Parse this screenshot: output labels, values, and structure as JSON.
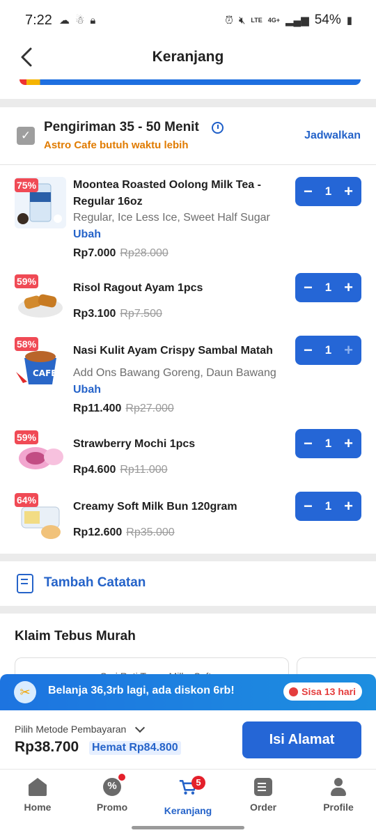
{
  "status_bar": {
    "time": "7:22",
    "battery": "54%",
    "network": "LTE",
    "net_gen": "4G+"
  },
  "header": {
    "title": "Keranjang"
  },
  "delivery": {
    "title": "Pengiriman 35 - 50 Menit",
    "subtitle": "Astro Cafe butuh waktu lebih",
    "schedule_label": "Jadwalkan"
  },
  "items": [
    {
      "discount": "75%",
      "name": "Moontea Roasted Oolong Milk Tea - Regular 16oz",
      "variant": "Regular, Ice Less Ice, Sweet Half Sugar",
      "edit_label": "Ubah",
      "price": "Rp7.000",
      "old_price": "Rp28.000",
      "qty": "1"
    },
    {
      "discount": "59%",
      "name": "Risol Ragout Ayam 1pcs",
      "price": "Rp3.100",
      "old_price": "Rp7.500",
      "qty": "1"
    },
    {
      "discount": "58%",
      "name": "Nasi Kulit Ayam Crispy Sambal Matah",
      "variant": "Add Ons Bawang Goreng, Daun Bawang",
      "edit_label": "Ubah",
      "price": "Rp11.400",
      "old_price": "Rp27.000",
      "qty": "1"
    },
    {
      "discount": "59%",
      "name": "Strawberry Mochi 1pcs",
      "price": "Rp4.600",
      "old_price": "Rp11.000",
      "qty": "1"
    },
    {
      "discount": "64%",
      "name": "Creamy Soft Milk Bun 120gram",
      "price": "Rp12.600",
      "old_price": "Rp35.000",
      "qty": "1"
    }
  ],
  "note": {
    "label": "Tambah Catatan"
  },
  "klaim": {
    "title": "Klaim Tebus Murah",
    "card_text": "Sari Roti Tawar Milky Soft"
  },
  "promo": {
    "text": "Belanja 36,3rb lagi, ada diskon 6rb!",
    "timer": "Sisa 13 hari"
  },
  "checkout": {
    "payment_label": "Pilih Metode Pembayaran",
    "total": "Rp38.700",
    "savings": "Hemat Rp84.800",
    "cta": "Isi Alamat"
  },
  "nav": [
    {
      "label": "Home",
      "icon": "home-icon"
    },
    {
      "label": "Promo",
      "icon": "promo-icon"
    },
    {
      "label": "Keranjang",
      "icon": "cart-icon",
      "badge": "5",
      "active": true
    },
    {
      "label": "Order",
      "icon": "order-icon"
    },
    {
      "label": "Profile",
      "icon": "profile-icon"
    }
  ],
  "colors": {
    "primary": "#2566d6",
    "discount": "#f04a55",
    "warning": "#e07b00"
  }
}
